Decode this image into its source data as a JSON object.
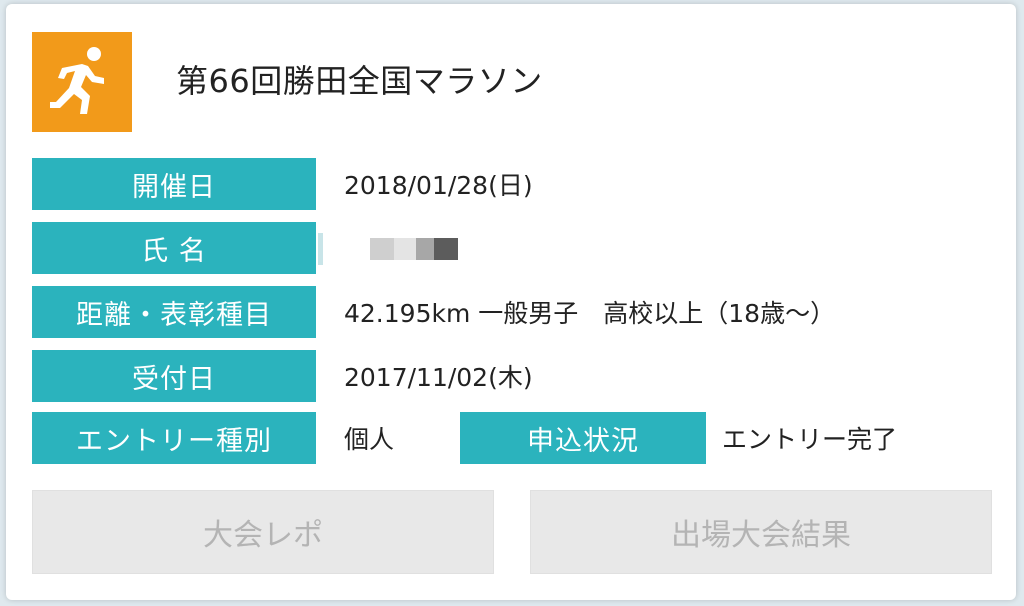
{
  "event": {
    "title": "第66回勝田全国マラソン"
  },
  "rows": [
    {
      "label": "開催日",
      "value": "2018/01/28(日)"
    },
    {
      "label": "氏 名",
      "value": ""
    },
    {
      "label": "距離・表彰種目",
      "value": "42.195km 一般男子　高校以上（18歳〜）"
    },
    {
      "label": "受付日",
      "value": "2017/11/02(木)"
    },
    {
      "label": "エントリー種別",
      "value": "個人"
    }
  ],
  "status": {
    "label": "申込状況",
    "value": "エントリー完了"
  },
  "buttons": {
    "report": "大会レポ",
    "results": "出場大会結果"
  },
  "colors": {
    "accent": "#2bb3bd",
    "logo": "#f29a1a",
    "disabled": "#e8e8e8"
  },
  "icons": {
    "logo": "runner-icon"
  }
}
